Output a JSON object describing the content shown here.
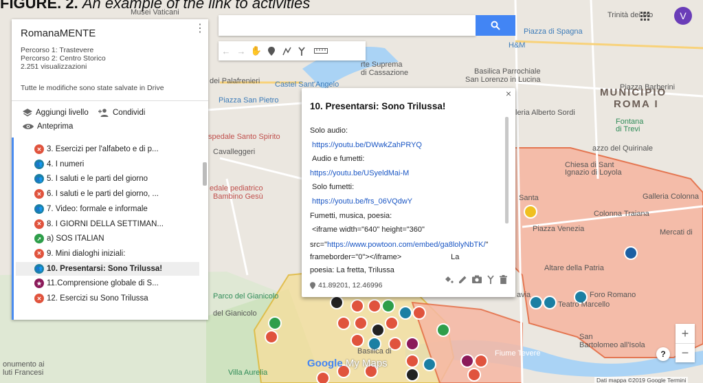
{
  "caption": {
    "prefix": "FIGURE. 2.",
    "text": "An example of the link to activities"
  },
  "sidebar": {
    "title": "RomanaMENTE",
    "routes": [
      "Percorso 1: Trastevere",
      "Percorso 2: Centro Storico"
    ],
    "views": "2.251 visualizzazioni",
    "saved": "Tutte le modifiche sono state salvate in Drive",
    "add_layer": "Aggiungi livello",
    "share": "Condividi",
    "preview": "Anteprima",
    "items": [
      {
        "label": "3. Esercizi per l'alfabeto e di p...",
        "color": "#e0533d",
        "icon": "cross-marker-icon",
        "glyph": "✕"
      },
      {
        "label": "4. I numeri",
        "color": "#1b7fa3",
        "icon": "people-marker-icon",
        "glyph": "👥"
      },
      {
        "label": "5. I saluti e le parti del giorno",
        "color": "#1b7fa3",
        "icon": "people-marker-icon",
        "glyph": "👥"
      },
      {
        "label": "6. I saluti e le parti del giorno, ...",
        "color": "#e0533d",
        "icon": "cross-marker-icon",
        "glyph": "✕"
      },
      {
        "label": "7. Video: formale e informale",
        "color": "#1b7fa3",
        "icon": "people-marker-icon",
        "glyph": "👥"
      },
      {
        "label": "8. I GIORNI DELLA SETTIMAN...",
        "color": "#e0533d",
        "icon": "cross-marker-icon",
        "glyph": "✕"
      },
      {
        "label": "a) SOS ITALIAN",
        "color": "#2e9e4a",
        "icon": "runner-marker-icon",
        "glyph": "➚"
      },
      {
        "label": "9. Mini dialoghi iniziali:",
        "color": "#e0533d",
        "icon": "cross-marker-icon",
        "glyph": "✕"
      },
      {
        "label": "10. Presentarsi: Sono Trilussa!",
        "color": "#1b7fa3",
        "icon": "people-marker-icon",
        "glyph": "👥",
        "selected": true
      },
      {
        "label": "11.Comprensione globale di S...",
        "color": "#8b1a5a",
        "icon": "star-marker-icon",
        "glyph": "★"
      },
      {
        "label": "12. Esercizi su Sono Trilussa",
        "color": "#e0533d",
        "icon": "cross-marker-icon",
        "glyph": "✕"
      }
    ]
  },
  "search": {
    "placeholder": ""
  },
  "toolbar": [
    "undo-icon",
    "redo-icon",
    "hand-icon",
    "marker-icon",
    "draw-line-icon",
    "directions-icon",
    "ruler-icon"
  ],
  "popup": {
    "title": "10. Presentarsi: Sono Trilussa!",
    "l1": "Solo audio:",
    "link1": "https://youtu.be/DWwkZahPRYQ",
    "l2": "Audio e fumetti:",
    "link2": "https://youtu.be/USyeldMai-M",
    "l3": "Solo fumetti:",
    "link3": "https://youtu.be/frs_06VQdwY",
    "l4": "Fumetti, musica, poesia:",
    "l5": "<iframe width=\"640\" height=\"360\"",
    "src_prefix": "src=\"",
    "src_link": "https://www.powtoon.com/embed/ga8lolyNbTK/",
    "src_suffix": "\" frameborder=\"0\"></iframe>",
    "la": "La",
    "l7": "poesia: La fretta, Trilussa",
    "coords": "41.89201, 12.46996"
  },
  "map_labels": {
    "musei": "Musei Vaticani",
    "trinita": "Trinità dei Mo",
    "spagna": "Piazza di Spagna",
    "hm": "H&M",
    "suprema": "rte Suprema",
    "cassazione": "di Cassazione",
    "palafrenieri": "dei Palafrenieri",
    "basilica_lorenzo": "Basilica Parrochiale",
    "lorenzo2": "San Lorenzo in Lucina",
    "barberini": "Piazza Barberini",
    "municipio": "MUNICIPIO",
    "roma1": "ROMA I",
    "castel": "Castel Sant'Angelo",
    "piazza_pietro": "Piazza San Pietro",
    "sordi": "leria Alberto Sordi",
    "fontana": "Fontana",
    "trevi": "di Trevi",
    "spirito": "spedale Santo Spirito",
    "cavalleggeri": "Cavalleggeri",
    "quirinale": "azzo del Quirinale",
    "chiesa": "Chiesa di Sant",
    "ignazio": "Ignazio di Loyola",
    "bambino1": "edale pediatrico",
    "bambino2": "Bambino Gesù",
    "santa": "Santa",
    "colonna": "Galleria Colonna",
    "traiana": "Colonna Traiana",
    "venezia": "Piazza Venezia",
    "mercati": "Mercati di",
    "altare": "Altare della Patria",
    "parco": "Parco del Gianicolo",
    "gianicolo": "del Gianicolo",
    "foro": "Foro Romano",
    "marcello": "Teatro Marcello",
    "basilica_s": "Basilica di",
    "fiume": "Fiume Tevere",
    "bartolomeo1": "San",
    "bartolomeo2": "Bartolomeo all'Isola",
    "monumento1": "onumento ai",
    "monumento2": "luti Francesi",
    "pamphili": "Villa Aurelia",
    "avia": "avia",
    "m": "M"
  },
  "user": {
    "avatar": "V"
  },
  "logo": {
    "g": "Google",
    "m": "My Maps"
  },
  "footer": "Dati mappa ©2019 Google   Termini",
  "colors": {
    "accent": "#4285f4",
    "zone_fill": "#f4a996",
    "zone_stroke": "#e8603a",
    "yellow_zone": "#f0d060"
  }
}
